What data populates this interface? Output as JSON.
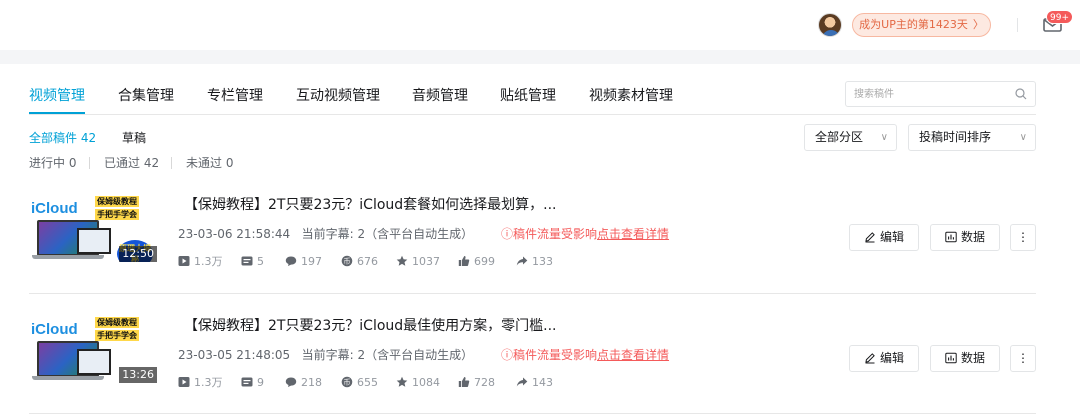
{
  "topbar": {
    "up_badge": "成为UP主的第1423天",
    "up_badge_chevron": "〉",
    "message_count": "99+"
  },
  "tabs": [
    {
      "label": "视频管理",
      "active": true
    },
    {
      "label": "合集管理"
    },
    {
      "label": "专栏管理"
    },
    {
      "label": "互动视频管理"
    },
    {
      "label": "音频管理"
    },
    {
      "label": "贴纸管理"
    },
    {
      "label": "视频素材管理"
    }
  ],
  "search": {
    "placeholder": "搜索稿件"
  },
  "filters": {
    "all": "全部稿件 42",
    "draft": "草稿",
    "in_progress": "进行中 0",
    "approved": "已通过 42",
    "rejected": "未通过 0"
  },
  "dropdowns": {
    "category": "全部分区",
    "sort": "投稿时间排序",
    "chevron": "∨"
  },
  "videos": [
    {
      "title": "【保姆教程】2T只要23元？iCloud套餐如何选择最划算，...",
      "datetime": "23-03-06 21:58:44",
      "subtitle": "当前字幕: 2（含平台自动生成）",
      "warning_prefix": "ⓘ稿件流量受影响",
      "warning_link": "点击查看详情",
      "duration": "12:50",
      "thumb_text": {
        "brand": "iCloud",
        "tag1": "保姆级教程",
        "tag2": "手把手学会",
        "bubble": "原理大揭秘"
      },
      "stats": {
        "plays": "1.3万",
        "danmaku": "5",
        "comments": "197",
        "coins": "676",
        "favorites": "1037",
        "likes": "699",
        "shares": "133"
      }
    },
    {
      "title": "【保姆教程】2T只要23元？iCloud最佳使用方案，零门槛...",
      "datetime": "23-03-05 21:48:05",
      "subtitle": "当前字幕: 2（含平台自动生成）",
      "warning_prefix": "ⓘ稿件流量受影响",
      "warning_link": "点击查看详情",
      "duration": "13:26",
      "thumb_text": {
        "brand": "iCloud",
        "tag1": "保姆级教程",
        "tag2": "手把手学会"
      },
      "stats": {
        "plays": "1.3万",
        "danmaku": "9",
        "comments": "218",
        "coins": "655",
        "favorites": "1084",
        "likes": "728",
        "shares": "143"
      }
    }
  ],
  "actions": {
    "edit": "编辑",
    "data": "数据",
    "more": "⋮"
  },
  "colors": {
    "accent": "#00a1d6",
    "warning": "#f45a5a",
    "badge_text": "#e36844"
  }
}
